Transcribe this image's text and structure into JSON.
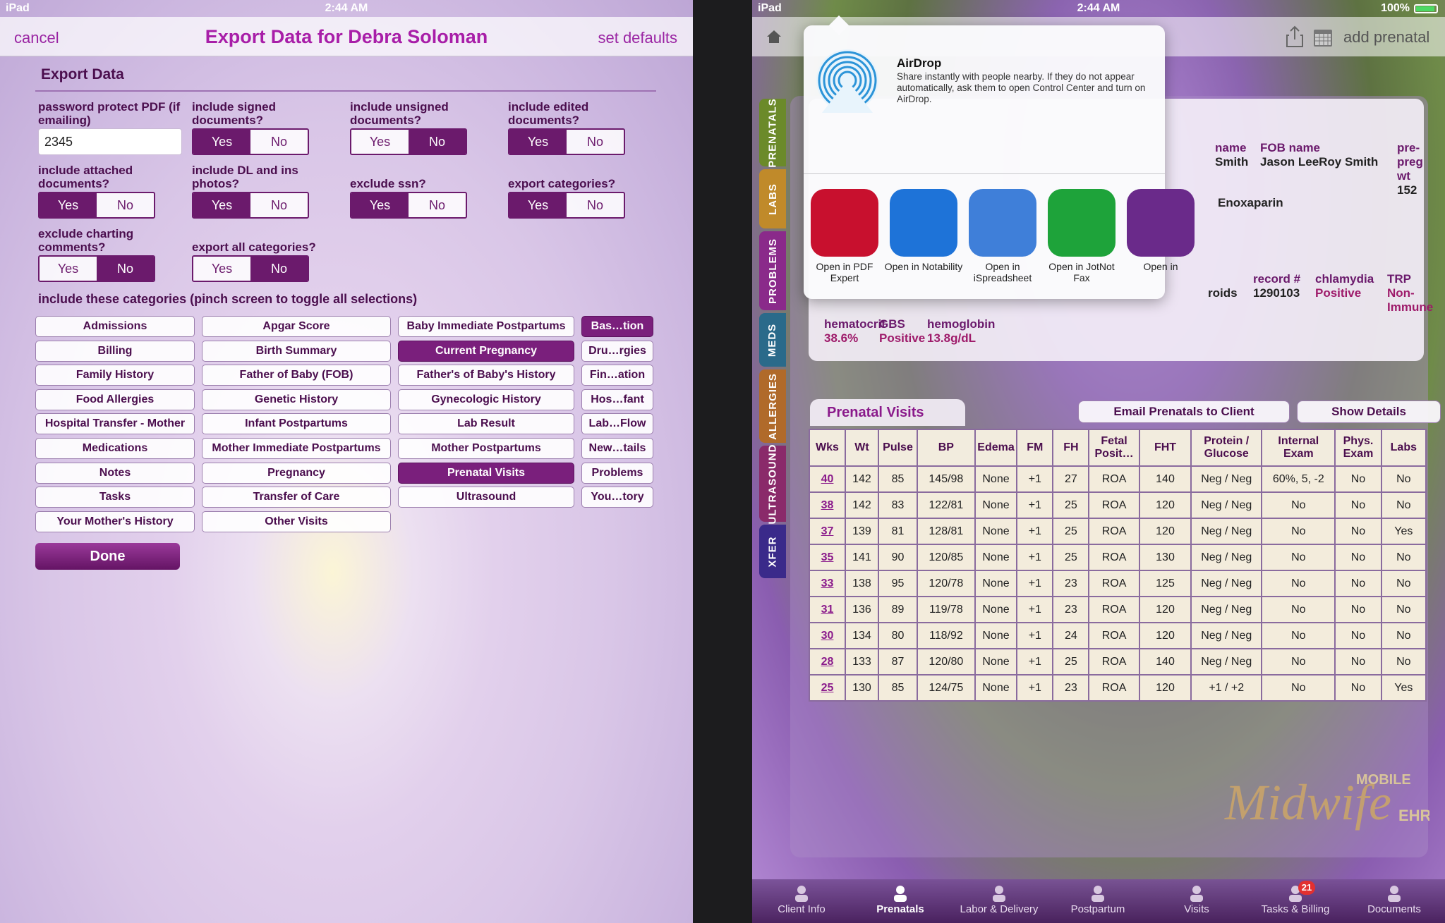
{
  "left": {
    "status": {
      "carrier": "iPad",
      "time": "2:44 AM"
    },
    "nav": {
      "cancel": "cancel",
      "title": "Export Data for Debra Soloman",
      "set_defaults": "set defaults"
    },
    "section_title": "Export Data",
    "password": {
      "label": "password protect PDF (if emailing)",
      "value": "2345"
    },
    "questions": [
      {
        "label": "include signed documents?",
        "yes": "Yes",
        "no": "No",
        "selected": "Yes"
      },
      {
        "label": "include unsigned documents?",
        "yes": "Yes",
        "no": "No",
        "selected": "No"
      },
      {
        "label": "include edited documents?",
        "yes": "Yes",
        "no": "No",
        "selected": "Yes"
      },
      {
        "label": "include attached documents?",
        "yes": "Yes",
        "no": "No",
        "selected": "Yes"
      },
      {
        "label": "include DL and ins photos?",
        "yes": "Yes",
        "no": "No",
        "selected": "Yes"
      },
      {
        "label": "exclude ssn?",
        "yes": "Yes",
        "no": "No",
        "selected": "Yes"
      },
      {
        "label": "export categories?",
        "yes": "Yes",
        "no": "No",
        "selected": "Yes"
      },
      {
        "label": "exclude charting comments?",
        "yes": "Yes",
        "no": "No",
        "selected": "No"
      },
      {
        "label": "export all categories?",
        "yes": "Yes",
        "no": "No",
        "selected": "No"
      }
    ],
    "categories_title": "include these categories (pinch screen to toggle all selections)",
    "categories": [
      [
        "Admissions",
        "Billing",
        "Family History",
        "Food Allergies",
        "Hospital Transfer - Mother",
        "Medications",
        "Notes",
        "Tasks",
        "Your Mother's History"
      ],
      [
        "Apgar Score",
        "Birth Summary",
        "Father of Baby (FOB)",
        "Genetic History",
        "Infant Postpartums",
        "Mother Immediate Postpartums",
        "Pregnancy",
        "Transfer of Care",
        "Other Visits"
      ],
      [
        "Baby Immediate Postpartums",
        "Current Pregnancy",
        "Father's of Baby's History",
        "Gynecologic History",
        "Lab Result",
        "Mother Postpartums",
        "Prenatal Visits",
        "Ultrasound"
      ],
      [
        "Bas…tion",
        "Dru…rgies",
        "Fin…ation",
        "Hos…fant",
        "Lab…Flow",
        "New…tails",
        "Problems",
        "You…tory"
      ]
    ],
    "selected_categories": [
      "Current Pregnancy",
      "Prenatal Visits",
      "Bas…tion"
    ],
    "done": "Done"
  },
  "right": {
    "status": {
      "carrier": "iPad",
      "time": "2:44 AM",
      "battery": "100%"
    },
    "nav": {
      "add_prenatal": "add prenatal"
    },
    "side_tabs": [
      "PRENATALS",
      "LABS",
      "PROBLEMS",
      "MEDS",
      "ALLERGIES",
      "ULTRASOUND",
      "XFER"
    ],
    "side_tab_colors": [
      "#6b8a2a",
      "#c08a2a",
      "#8a2a8a",
      "#2a6a8a",
      "#b06a2a",
      "#8a2a6a",
      "#3a2a8a"
    ],
    "info": {
      "name_label": "name",
      "name_value": "Smith",
      "fob_label": "FOB name",
      "fob_value": "Jason LeeRoy Smith",
      "prepreg_label": "pre-preg wt",
      "prepreg_value": "152",
      "med_value": "Enoxaparin",
      "roids_value": "roids",
      "record_label": "record #",
      "record_value": "1290103",
      "chlamydia_label": "chlamydia",
      "chlamydia_value": "Positive",
      "trp_label": "TRP",
      "trp_value": "Non-Immune",
      "hematocrit_label": "hematocrit",
      "hematocrit_value": "38.6%",
      "gbs_label": "GBS",
      "gbs_value": "Positive",
      "hemoglobin_label": "hemoglobin",
      "hemoglobin_value": "13.8g/dL"
    },
    "share": {
      "airdrop_title": "AirDrop",
      "airdrop_text": "Share instantly with people nearby. If they do not appear automatically, ask them to open Control Center and turn on AirDrop.",
      "apps": [
        {
          "label": "Open in PDF Expert",
          "icon": "pdf-expert-icon",
          "color": "#c8102e"
        },
        {
          "label": "Open in Notability",
          "icon": "notability-icon",
          "color": "#1e73d8"
        },
        {
          "label": "Open in iSpreadsheet",
          "icon": "ispreadsheet-icon",
          "color": "#3f7fd9"
        },
        {
          "label": "Open in JotNot Fax",
          "icon": "jotnot-fax-icon",
          "color": "#1ea33a"
        },
        {
          "label": "Open in",
          "icon": "app-icon",
          "color": "#6a2a8a"
        }
      ]
    },
    "prenatal_visits": {
      "title": "Prenatal Visits",
      "email_button": "Email Prenatals to Client",
      "details_button": "Show Details",
      "columns": [
        "Wks",
        "Wt",
        "Pulse",
        "BP",
        "Edema",
        "FM",
        "FH",
        "Fetal Posit…",
        "FHT",
        "Protein / Glucose",
        "Internal Exam",
        "Phys. Exam",
        "Labs"
      ],
      "rows": [
        [
          "40",
          "142",
          "85",
          "145/98",
          "None",
          "+1",
          "27",
          "ROA",
          "140",
          "Neg / Neg",
          "60%, 5, -2",
          "No",
          "No"
        ],
        [
          "38",
          "142",
          "83",
          "122/81",
          "None",
          "+1",
          "25",
          "ROA",
          "120",
          "Neg / Neg",
          "No",
          "No",
          "No"
        ],
        [
          "37",
          "139",
          "81",
          "128/81",
          "None",
          "+1",
          "25",
          "ROA",
          "120",
          "Neg / Neg",
          "No",
          "No",
          "Yes"
        ],
        [
          "35",
          "141",
          "90",
          "120/85",
          "None",
          "+1",
          "25",
          "ROA",
          "130",
          "Neg / Neg",
          "No",
          "No",
          "No"
        ],
        [
          "33",
          "138",
          "95",
          "120/78",
          "None",
          "+1",
          "23",
          "ROA",
          "125",
          "Neg / Neg",
          "No",
          "No",
          "No"
        ],
        [
          "31",
          "136",
          "89",
          "119/78",
          "None",
          "+1",
          "23",
          "ROA",
          "120",
          "Neg / Neg",
          "No",
          "No",
          "No"
        ],
        [
          "30",
          "134",
          "80",
          "118/92",
          "None",
          "+1",
          "24",
          "ROA",
          "120",
          "Neg / Neg",
          "No",
          "No",
          "No"
        ],
        [
          "28",
          "133",
          "87",
          "120/80",
          "None",
          "+1",
          "25",
          "ROA",
          "140",
          "Neg / Neg",
          "No",
          "No",
          "No"
        ],
        [
          "25",
          "130",
          "85",
          "124/75",
          "None",
          "+1",
          "23",
          "ROA",
          "120",
          "+1 / +2",
          "No",
          "No",
          "Yes"
        ]
      ]
    },
    "logo": {
      "mobile": "MOBILE",
      "name": "Midwife",
      "ehr": "EHR"
    },
    "tabbar": [
      {
        "label": "Client Info",
        "icon": "person-icon"
      },
      {
        "label": "Prenatals",
        "icon": "heartbeat-icon",
        "active": true
      },
      {
        "label": "Labor & Delivery",
        "icon": "baby-icon"
      },
      {
        "label": "Postpartum",
        "icon": "house-icon"
      },
      {
        "label": "Visits",
        "icon": "medical-bag-icon"
      },
      {
        "label": "Tasks & Billing",
        "icon": "inbox-icon",
        "badge": "21"
      },
      {
        "label": "Documents",
        "icon": "file-cabinet-icon"
      }
    ]
  }
}
